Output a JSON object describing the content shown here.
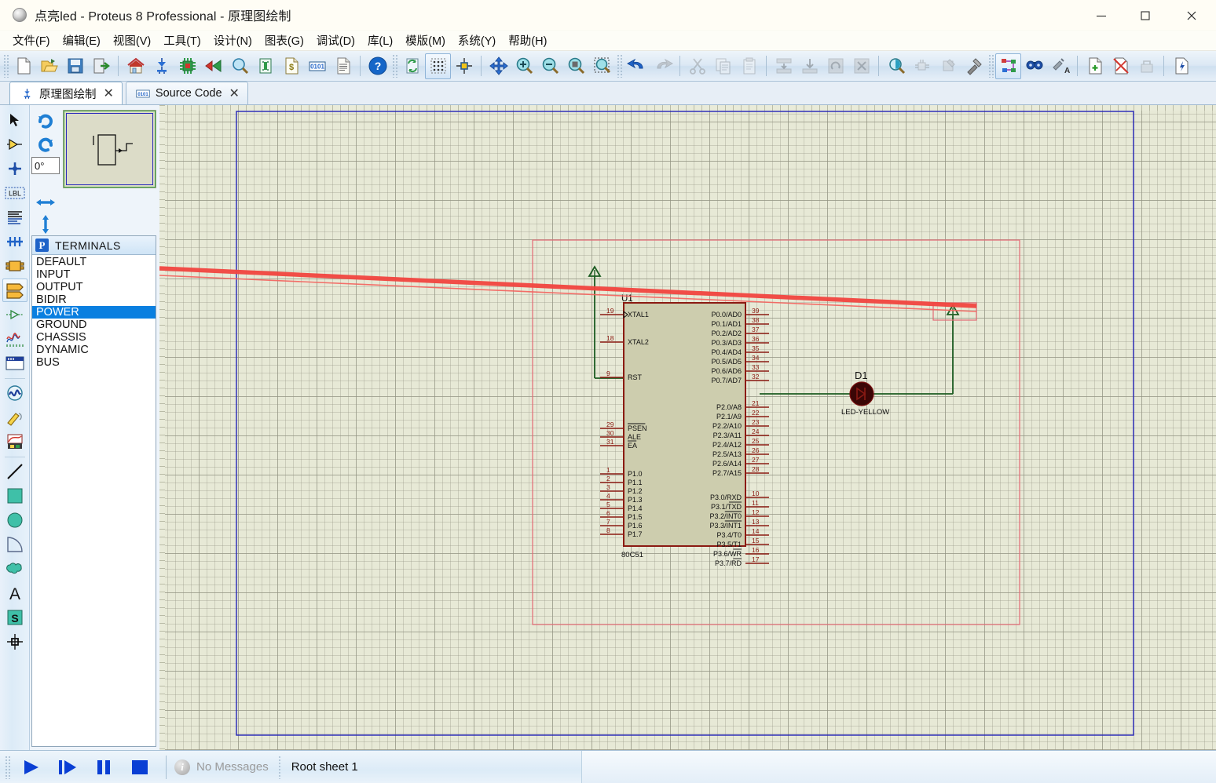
{
  "window": {
    "title": "点亮led - Proteus 8 Professional - 原理图绘制",
    "app_icon": "proteus-sphere-icon",
    "minimize_label": "—",
    "maximize_label": "□",
    "close_label": "✕"
  },
  "menu": {
    "items": [
      {
        "label": "文件(F)",
        "name": "menu-file"
      },
      {
        "label": "编辑(E)",
        "name": "menu-edit"
      },
      {
        "label": "视图(V)",
        "name": "menu-view"
      },
      {
        "label": "工具(T)",
        "name": "menu-tools"
      },
      {
        "label": "设计(N)",
        "name": "menu-design"
      },
      {
        "label": "图表(G)",
        "name": "menu-graph"
      },
      {
        "label": "调试(D)",
        "name": "menu-debug"
      },
      {
        "label": "库(L)",
        "name": "menu-library"
      },
      {
        "label": "模版(M)",
        "name": "menu-template"
      },
      {
        "label": "系统(Y)",
        "name": "menu-system"
      },
      {
        "label": "帮助(H)",
        "name": "menu-help"
      }
    ]
  },
  "toolbar": {
    "groups": [
      [
        "new-file-icon",
        "open-file-icon",
        "save-file-icon",
        "exit-icon"
      ],
      [
        "home-icon",
        "schematic-capture-icon",
        "pcb-layout-icon",
        "3d-visualizer-icon",
        "design-explorer-icon",
        "bill-of-materials-icon",
        "cost-icon",
        "source-code-icon",
        "report-icon"
      ],
      [
        "help-icon"
      ],
      [
        "refresh-icon",
        "toggle-grid-icon",
        "origin-icon"
      ],
      [
        "pan-icon",
        "zoom-in-icon",
        "zoom-out-icon",
        "zoom-all-icon",
        "zoom-area-icon"
      ],
      [
        "undo-icon",
        "redo-icon"
      ],
      [
        "cut-icon",
        "copy-icon",
        "paste-icon"
      ],
      [
        "block-copy-icon",
        "block-move-icon",
        "block-rotate-icon",
        "block-delete-icon"
      ],
      [
        "pick-device-icon",
        "make-device-icon",
        "packaging-tool-icon",
        "decompose-icon"
      ],
      [
        "wire-autorouter-icon",
        "search-tag-icon",
        "property-assignment-icon"
      ],
      [
        "new-sheet-icon",
        "remove-sheet-icon",
        "exit-sheet-icon",
        "design-notes-icon"
      ]
    ]
  },
  "tabs": [
    {
      "label": "原理图绘制",
      "icon": "schematic-capture-icon",
      "active": true,
      "close": "✕"
    },
    {
      "label": "Source Code",
      "icon": "source-code-icon",
      "active": false,
      "close": "✕"
    }
  ],
  "left_toolbar": {
    "tools": [
      {
        "name": "selection-mode-icon",
        "active": false
      },
      {
        "name": "component-mode-icon",
        "active": false
      },
      {
        "name": "junction-dot-mode-icon",
        "active": false
      },
      {
        "name": "wire-label-mode-icon",
        "active": false
      },
      {
        "name": "text-script-mode-icon",
        "active": false
      },
      {
        "name": "buses-mode-icon",
        "active": false
      },
      {
        "name": "subcircuit-mode-icon",
        "active": false
      },
      {
        "name": "terminals-mode-icon",
        "active": true
      },
      {
        "name": "device-pin-mode-icon",
        "active": false
      },
      {
        "name": "graph-mode-icon",
        "active": false
      },
      {
        "name": "tape-recorder-mode-icon",
        "active": false
      },
      {
        "name": "generator-mode-icon",
        "active": false
      },
      {
        "name": "voltage-probe-mode-icon",
        "active": false
      },
      {
        "name": "virtual-instruments-mode-icon",
        "active": false
      },
      {
        "name": "line-tool-icon",
        "active": false
      },
      {
        "name": "box-tool-icon",
        "active": false
      },
      {
        "name": "circle-tool-icon",
        "active": false
      },
      {
        "name": "arc-tool-icon",
        "active": false
      },
      {
        "name": "path-tool-icon",
        "active": false
      },
      {
        "name": "text-tool-icon",
        "active": false
      },
      {
        "name": "symbol-tool-icon",
        "active": false
      },
      {
        "name": "marker-tool-icon",
        "active": false
      }
    ]
  },
  "orientation": {
    "rotate_cw_icon": "rotate-clockwise-icon",
    "rotate_ccw_icon": "rotate-counterclockwise-icon",
    "angle_value": "0°",
    "mirror_x_icon": "mirror-horizontal-icon",
    "mirror_y_icon": "mirror-vertical-icon"
  },
  "palette": {
    "badge": "P",
    "title": "TERMINALS",
    "items": [
      {
        "label": "DEFAULT",
        "selected": false
      },
      {
        "label": "INPUT",
        "selected": false
      },
      {
        "label": "OUTPUT",
        "selected": false
      },
      {
        "label": "BIDIR",
        "selected": false
      },
      {
        "label": "POWER",
        "selected": true
      },
      {
        "label": "GROUND",
        "selected": false
      },
      {
        "label": "CHASSIS",
        "selected": false
      },
      {
        "label": "DYNAMIC",
        "selected": false
      },
      {
        "label": "BUS",
        "selected": false
      }
    ]
  },
  "schematic": {
    "mcu": {
      "reference": "U1",
      "part_name": "80C51",
      "left_pins": [
        {
          "num": "19",
          "label": "XTAL1"
        },
        {
          "num": "18",
          "label": "XTAL2"
        },
        {
          "num": "9",
          "label": "RST"
        },
        {
          "num": "29",
          "label": "PSEN"
        },
        {
          "num": "30",
          "label": "ALE"
        },
        {
          "num": "31",
          "label": "EA"
        },
        {
          "num": "1",
          "label": "P1.0"
        },
        {
          "num": "2",
          "label": "P1.1"
        },
        {
          "num": "3",
          "label": "P1.2"
        },
        {
          "num": "4",
          "label": "P1.3"
        },
        {
          "num": "5",
          "label": "P1.4"
        },
        {
          "num": "6",
          "label": "P1.5"
        },
        {
          "num": "7",
          "label": "P1.6"
        },
        {
          "num": "8",
          "label": "P1.7"
        }
      ],
      "right_pins": [
        {
          "num": "39",
          "label": "P0.0/AD0"
        },
        {
          "num": "38",
          "label": "P0.1/AD1"
        },
        {
          "num": "37",
          "label": "P0.2/AD2"
        },
        {
          "num": "36",
          "label": "P0.3/AD3"
        },
        {
          "num": "35",
          "label": "P0.4/AD4"
        },
        {
          "num": "34",
          "label": "P0.5/AD5"
        },
        {
          "num": "33",
          "label": "P0.6/AD6"
        },
        {
          "num": "32",
          "label": "P0.7/AD7"
        },
        {
          "num": "21",
          "label": "P2.0/A8"
        },
        {
          "num": "22",
          "label": "P2.1/A9"
        },
        {
          "num": "23",
          "label": "P2.2/A10"
        },
        {
          "num": "24",
          "label": "P2.3/A11"
        },
        {
          "num": "25",
          "label": "P2.4/A12"
        },
        {
          "num": "26",
          "label": "P2.5/A13"
        },
        {
          "num": "27",
          "label": "P2.6/A14"
        },
        {
          "num": "28",
          "label": "P2.7/A15"
        },
        {
          "num": "10",
          "label": "P3.0/RXD"
        },
        {
          "num": "11",
          "label": "P3.1/TXD"
        },
        {
          "num": "12",
          "label": "P3.2/INT0"
        },
        {
          "num": "13",
          "label": "P3.3/INT1"
        },
        {
          "num": "14",
          "label": "P3.4/T0"
        },
        {
          "num": "15",
          "label": "P3.5/T1"
        },
        {
          "num": "16",
          "label": "P3.6/WR"
        },
        {
          "num": "17",
          "label": "P3.7/RD"
        }
      ]
    },
    "led": {
      "reference": "D1",
      "part_name": "LED-YELLOW"
    },
    "terminals": [
      {
        "name": "power-terminal-left",
        "kind": "POWER"
      },
      {
        "name": "power-terminal-right",
        "kind": "POWER",
        "selected": true
      }
    ],
    "colors": {
      "sheet_border": "#2424b8",
      "selection": "#e36a74",
      "wire": "#1c5c22",
      "body_fill": "#cdcdae",
      "body_outline": "#8b1a12",
      "grid_bg": "#e7e9d6",
      "annotation_arrow": "#f1443f"
    }
  },
  "status": {
    "play_icon": "play-icon",
    "step_icon": "step-icon",
    "pause_icon": "pause-icon",
    "stop_icon": "stop-icon",
    "message": "No Messages",
    "sheet": "Root sheet 1"
  }
}
